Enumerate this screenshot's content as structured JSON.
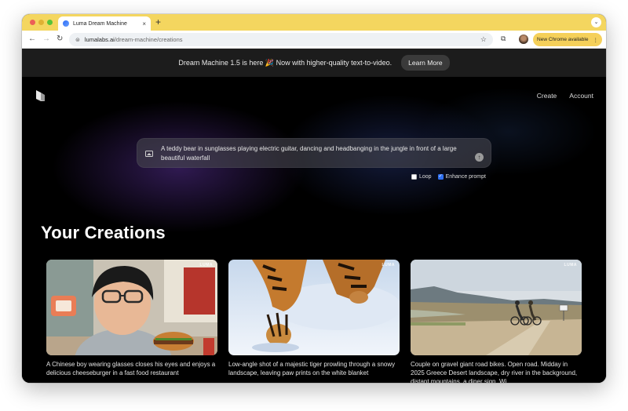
{
  "browser": {
    "tab_title": "Luma Dream Machine",
    "tab_close": "×",
    "new_tab": "+",
    "tab_search": "⌄",
    "url_host": "lumalabs.ai",
    "url_path": "/dream-machine/creations",
    "update_label": "New Chrome available",
    "back": "←",
    "forward": "→",
    "reload": "↻",
    "star": "☆",
    "extensions": "⧉",
    "site_info": "⊜",
    "menu": "⋮"
  },
  "banner": {
    "text": "Dream Machine 1.5 is here 🎉 Now with higher-quality text-to-video.",
    "button": "Learn More"
  },
  "nav": {
    "create": "Create",
    "account": "Account"
  },
  "prompt": {
    "text": "A teddy bear in sunglasses playing electric guitar, dancing and headbanging in the jungle in front of a large beautiful waterfall",
    "send": "↑"
  },
  "options": {
    "loop": "Loop",
    "loop_checked": false,
    "enhance": "Enhance prompt",
    "enhance_checked": true
  },
  "heading": "Your Creations",
  "creations": [
    {
      "badge": "LUMA",
      "caption": "A Chinese boy wearing glasses closes his eyes and enjoys a delicious cheeseburger in a fast food restaurant"
    },
    {
      "badge": "LUMA",
      "caption": "Low-angle shot of a majestic tiger prowling through a snowy landscape, leaving paw prints on the white blanket"
    },
    {
      "badge": "LUMA",
      "caption": "Couple on gravel giant road bikes. Open road. Midday in 2025 Greece Desert landscape, dry river in the background, distant mountains, a diner sign. Wi..."
    }
  ]
}
